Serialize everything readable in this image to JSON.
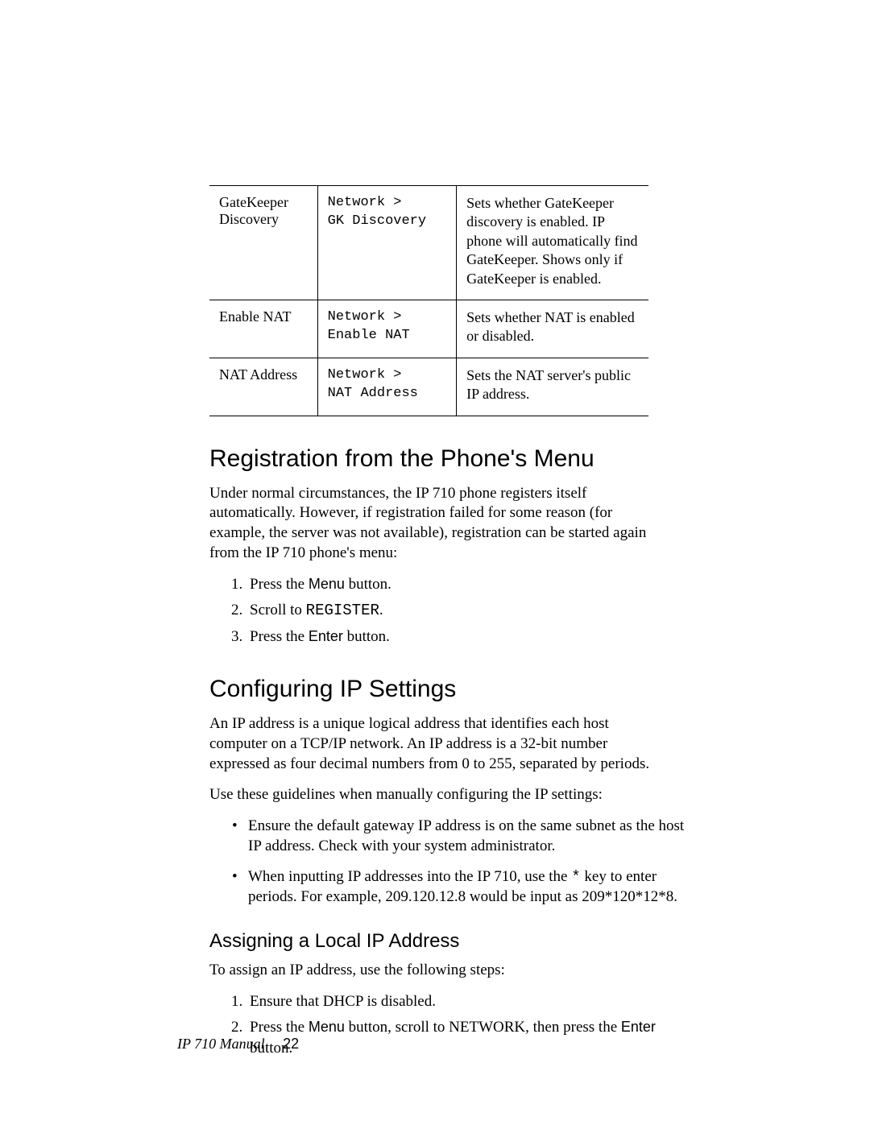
{
  "table": {
    "rows": [
      {
        "name": "GateKeeper Discovery",
        "path_line1": "Network >",
        "path_line2": "GK Discovery",
        "desc": "Sets whether GateKeeper discovery is enabled. IP phone will automatically find GateKeeper. Shows only if GateKeeper is enabled."
      },
      {
        "name": "Enable NAT",
        "path_line1": "Network >",
        "path_line2": "Enable NAT",
        "desc": "Sets whether NAT is enabled or disabled."
      },
      {
        "name": "NAT Address",
        "path_line1": "Network >",
        "path_line2": "NAT Address",
        "desc": "Sets the NAT server's public IP address."
      }
    ]
  },
  "section1": {
    "title": "Registration from the Phone's Menu",
    "intro": "Under normal circumstances, the IP 710 phone registers itself automatically. However, if registration failed for some reason (for example, the server was not available), registration can be started again from the IP 710 phone's menu:",
    "step1_pre": "Press the ",
    "step1_button": "Menu",
    "step1_post": " button.",
    "step2_pre": "Scroll to ",
    "step2_code": "REGISTER",
    "step2_post": ".",
    "step3_pre": "Press the ",
    "step3_button": "Enter",
    "step3_post": " button."
  },
  "section2": {
    "title": "Configuring IP Settings",
    "p1": "An IP address is a unique logical address that identifies each host computer on a TCP/IP network. An IP address is a 32-bit number expressed as four decimal numbers from 0 to 255, separated by periods.",
    "p2": "Use these guidelines when manually configuring the IP settings:",
    "bullet1": "Ensure the default gateway IP address is on the same subnet as the host IP address. Check with your system administrator.",
    "bullet2_pre": "When inputting IP addresses into the IP 710, use the ",
    "bullet2_key": "*",
    "bullet2_post": " key to enter periods. For example, 209.120.12.8 would be input as 209*120*12*8."
  },
  "subsection": {
    "title": "Assigning a Local IP Address",
    "intro": "To assign an IP address, use the following steps:",
    "step1": "Ensure that DHCP is disabled.",
    "step2_pre": "Press the ",
    "step2_menu": "Menu",
    "step2_mid1": " button, scroll to ",
    "step2_network": "NETWORK",
    "step2_mid2": ", then press the ",
    "step2_enter": "Enter",
    "step2_post": " button."
  },
  "footer": {
    "manual": "IP 710 Manual",
    "page": "22"
  }
}
